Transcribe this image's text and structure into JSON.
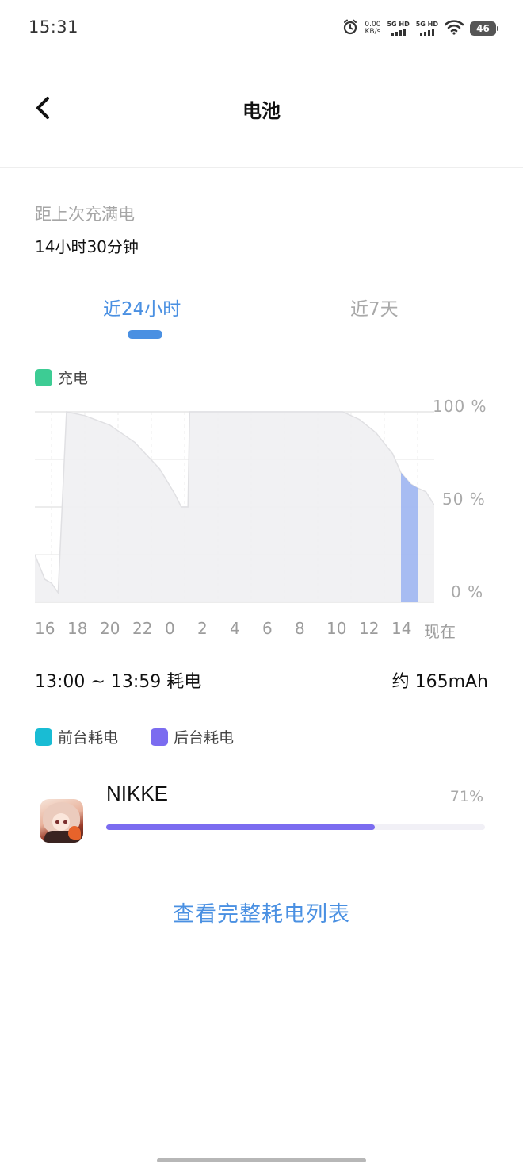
{
  "status_bar": {
    "time": "15:31",
    "net_speed_value": "0.00",
    "net_speed_unit": "KB/s",
    "sim1_label": "5G HD",
    "sim2_label": "5G HD",
    "battery_level": "46",
    "icons": [
      "alarm-icon",
      "signal-icon",
      "wifi-icon",
      "battery-icon"
    ]
  },
  "header": {
    "back_icon": "chevron-left-icon",
    "title": "电池"
  },
  "since_full_charge": {
    "label": "距上次充满电",
    "value": "14小时30分钟"
  },
  "tabs": [
    {
      "label": "近24小时",
      "selected": true
    },
    {
      "label": "近7天",
      "selected": false
    }
  ],
  "legend_top": {
    "charging_label": "充电",
    "charging_color": "#3dcc94"
  },
  "chart_data": {
    "type": "area",
    "x_tick_labels": [
      "16",
      "18",
      "20",
      "22",
      "0",
      "2",
      "4",
      "6",
      "8",
      "10",
      "12",
      "14",
      "现在"
    ],
    "y_tick_labels": [
      "100 %",
      "50 %",
      "0 %"
    ],
    "y_range": [
      0,
      100
    ],
    "x_unit": "hour",
    "x_range_hours": [
      15,
      39
    ],
    "x_note": "x = hours since 00:00 of the first day; 24 = midnight, 38.5 = 14:30 (现在)",
    "battery_level": [
      {
        "x": 15.0,
        "y": 25
      },
      {
        "x": 15.6,
        "y": 12
      },
      {
        "x": 16.0,
        "y": 10
      },
      {
        "x": 16.4,
        "y": 5
      },
      {
        "x": 16.9,
        "y": 100
      },
      {
        "x": 18.0,
        "y": 98
      },
      {
        "x": 19.5,
        "y": 93
      },
      {
        "x": 21.0,
        "y": 84
      },
      {
        "x": 22.5,
        "y": 70
      },
      {
        "x": 23.4,
        "y": 57
      },
      {
        "x": 23.8,
        "y": 50
      },
      {
        "x": 24.2,
        "y": 50
      },
      {
        "x": 24.3,
        "y": 100
      },
      {
        "x": 30.0,
        "y": 100
      },
      {
        "x": 33.5,
        "y": 100
      },
      {
        "x": 34.5,
        "y": 96
      },
      {
        "x": 35.5,
        "y": 89
      },
      {
        "x": 36.5,
        "y": 78
      },
      {
        "x": 37.0,
        "y": 68
      },
      {
        "x": 37.6,
        "y": 62
      },
      {
        "x": 38.0,
        "y": 60
      },
      {
        "x": 38.5,
        "y": 58
      },
      {
        "x": 39.0,
        "y": 51
      }
    ],
    "selected_range": {
      "start_hour": 37,
      "end_hour": 38,
      "label": "13:00 ~ 13:59"
    },
    "area_color": "#f0f0f2",
    "highlight_color": "#8ea9f2",
    "grid": true
  },
  "selection": {
    "range_label": "13:00 ~ 13:59 耗电",
    "consumption": "约 165mAh"
  },
  "legend_bottom": {
    "foreground_label": "前台耗电",
    "foreground_color": "#19bcd4",
    "background_label": "后台耗电",
    "background_color": "#7b6cf0"
  },
  "apps": [
    {
      "name": "NIKKE",
      "percent_label": "71%",
      "percent": 0.71,
      "icon": "nikke-app-icon"
    }
  ],
  "footer": {
    "full_list_link": "查看完整耗电列表"
  }
}
